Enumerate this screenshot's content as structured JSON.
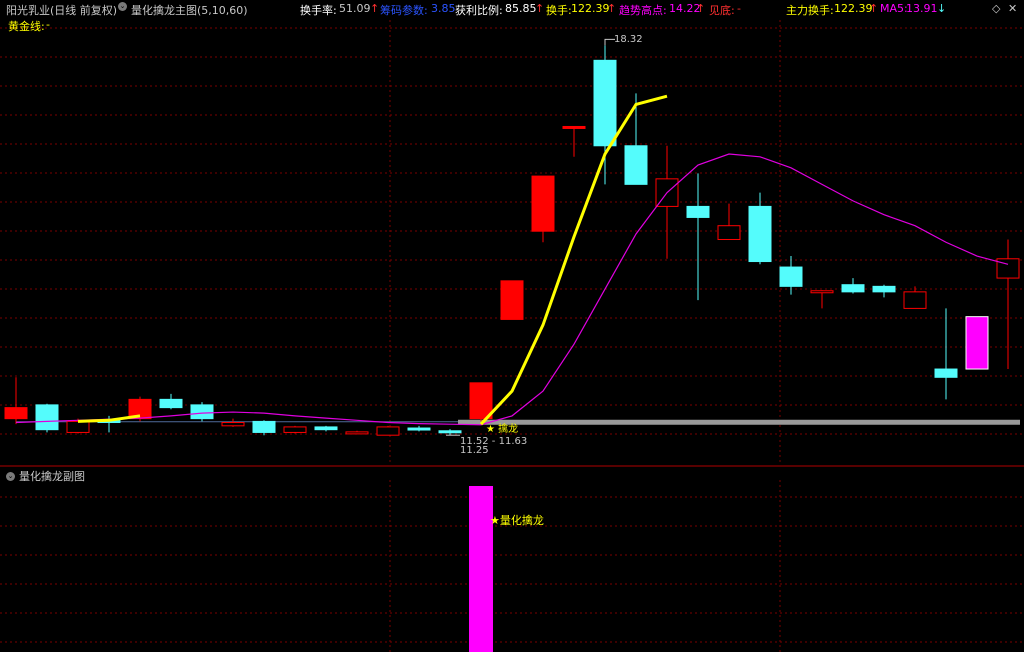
{
  "header": {
    "stock_title": "阳光乳业(日线 前复权)",
    "indicator_name": "量化擒龙主图(5,10,60)",
    "turnover_label": "换手率:",
    "turnover_value": "51.09",
    "chip_label": "筹码参数:",
    "chip_value": "3.85",
    "profit_label": "获利比例:",
    "profit_value": "85.85",
    "swap_label": "换手:",
    "swap_value": "122.39",
    "trend_label": "趋势高点:",
    "trend_value": "14.22",
    "bottom_label": "见底:",
    "bottom_value": "-",
    "main_swap_label": "主力换手:",
    "main_swap_value": "122.39",
    "ma5_label": "MA5:",
    "ma5_value": "13.91",
    "gold_line_label": "黄金线:",
    "gold_line_value": "-"
  },
  "sub_header": {
    "title": "量化擒龙副图"
  },
  "annotations": {
    "high_label": "18.32",
    "range_label": "11.52 - 11.63",
    "low_label": "11.25",
    "qinlong_label": "擒龙",
    "sub_signal_label": "量化擒龙"
  },
  "colors": {
    "up": "#ff0000",
    "down": "#54fcfc",
    "ma_line": "#e000e0",
    "yellow_line": "#ffff00",
    "signal": "#ff00ff",
    "support_bar": "#9a9a9a"
  },
  "chart_data": {
    "type": "candlestick",
    "price_range": [
      10.8,
      18.6
    ],
    "candles": [
      {
        "o": 11.55,
        "h": 12.3,
        "l": 11.45,
        "c": 11.75,
        "kind": "up_filled"
      },
      {
        "o": 11.8,
        "h": 11.82,
        "l": 11.3,
        "c": 11.35,
        "kind": "down"
      },
      {
        "o": 11.3,
        "h": 11.55,
        "l": 11.28,
        "c": 11.5,
        "kind": "up_hollow"
      },
      {
        "o": 11.52,
        "h": 11.6,
        "l": 11.3,
        "c": 11.48,
        "kind": "down"
      },
      {
        "o": 11.55,
        "h": 11.95,
        "l": 11.5,
        "c": 11.9,
        "kind": "up_filled"
      },
      {
        "o": 11.9,
        "h": 12.0,
        "l": 11.72,
        "c": 11.75,
        "kind": "down"
      },
      {
        "o": 11.8,
        "h": 11.85,
        "l": 11.5,
        "c": 11.55,
        "kind": "down"
      },
      {
        "o": 11.42,
        "h": 11.55,
        "l": 11.4,
        "c": 11.48,
        "kind": "up_hollow"
      },
      {
        "o": 11.5,
        "h": 11.52,
        "l": 11.25,
        "c": 11.3,
        "kind": "down"
      },
      {
        "o": 11.3,
        "h": 11.42,
        "l": 11.28,
        "c": 11.4,
        "kind": "up_hollow"
      },
      {
        "o": 11.4,
        "h": 11.42,
        "l": 11.32,
        "c": 11.35,
        "kind": "down"
      },
      {
        "o": 11.3,
        "h": 11.33,
        "l": 11.28,
        "c": 11.31,
        "kind": "up_hollow"
      },
      {
        "o": 11.25,
        "h": 11.42,
        "l": 11.25,
        "c": 11.4,
        "kind": "up_hollow"
      },
      {
        "o": 11.38,
        "h": 11.42,
        "l": 11.32,
        "c": 11.35,
        "kind": "down"
      },
      {
        "o": 11.33,
        "h": 11.36,
        "l": 11.25,
        "c": 11.3,
        "kind": "down"
      },
      {
        "o": 11.55,
        "h": 12.2,
        "l": 11.5,
        "c": 12.2,
        "kind": "up_filled"
      },
      {
        "o": 13.35,
        "h": 14.05,
        "l": 13.35,
        "c": 14.05,
        "kind": "up_filled"
      },
      {
        "o": 14.95,
        "h": 15.95,
        "l": 14.75,
        "c": 15.95,
        "kind": "up_filled"
      },
      {
        "o": 16.85,
        "h": 16.85,
        "l": 16.3,
        "c": 16.85,
        "kind": "up_filled"
      },
      {
        "o": 18.05,
        "h": 18.32,
        "l": 15.8,
        "c": 16.5,
        "kind": "down"
      },
      {
        "o": 16.5,
        "h": 17.45,
        "l": 15.8,
        "c": 15.8,
        "kind": "down"
      },
      {
        "o": 15.4,
        "h": 16.5,
        "l": 14.45,
        "c": 15.9,
        "kind": "up_hollow"
      },
      {
        "o": 15.4,
        "h": 16.0,
        "l": 13.7,
        "c": 15.2,
        "kind": "down"
      },
      {
        "o": 14.8,
        "h": 15.45,
        "l": 14.8,
        "c": 15.05,
        "kind": "up_hollow"
      },
      {
        "o": 15.4,
        "h": 15.65,
        "l": 14.35,
        "c": 14.4,
        "kind": "down"
      },
      {
        "o": 14.3,
        "h": 14.5,
        "l": 13.8,
        "c": 13.95,
        "kind": "down"
      },
      {
        "o": 13.85,
        "h": 13.88,
        "l": 13.55,
        "c": 13.87,
        "kind": "up_hollow"
      },
      {
        "o": 13.98,
        "h": 14.1,
        "l": 13.82,
        "c": 13.85,
        "kind": "down"
      },
      {
        "o": 13.95,
        "h": 13.98,
        "l": 13.75,
        "c": 13.85,
        "kind": "down"
      },
      {
        "o": 13.55,
        "h": 13.95,
        "l": 13.55,
        "c": 13.85,
        "kind": "up_hollow"
      },
      {
        "o": 12.45,
        "h": 13.55,
        "l": 11.9,
        "c": 12.3,
        "kind": "down"
      },
      {
        "o": 12.45,
        "h": 13.4,
        "l": 12.45,
        "c": 13.4,
        "kind": "signal"
      },
      {
        "o": 14.1,
        "h": 14.8,
        "l": 12.45,
        "c": 14.45,
        "kind": "up_hollow"
      }
    ],
    "ma_line": [
      11.48,
      11.5,
      11.52,
      11.54,
      11.56,
      11.6,
      11.65,
      11.67,
      11.65,
      11.6,
      11.56,
      11.52,
      11.48,
      11.46,
      11.45,
      11.44,
      11.6,
      12.05,
      12.9,
      13.9,
      14.9,
      15.65,
      16.15,
      16.35,
      16.3,
      16.1,
      15.8,
      15.5,
      15.25,
      15.05,
      14.75,
      14.5,
      14.35
    ],
    "yellow_line": [
      null,
      null,
      11.5,
      11.52,
      11.6,
      null,
      null,
      null,
      null,
      null,
      null,
      null,
      null,
      null,
      null,
      11.45,
      12.05,
      13.25,
      14.85,
      16.35,
      17.25,
      17.4
    ],
    "support_level": 11.53,
    "sub_signal_index": 15
  }
}
